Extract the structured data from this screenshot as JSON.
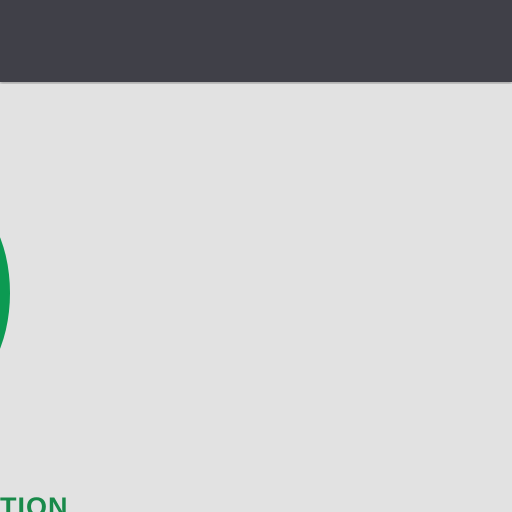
{
  "header": {
    "background": "#404048"
  },
  "main": {
    "background": "#e2e2e2",
    "badge": {
      "icon": "green-circle-icon",
      "color": "#0c9a52"
    },
    "caption": "TION"
  }
}
